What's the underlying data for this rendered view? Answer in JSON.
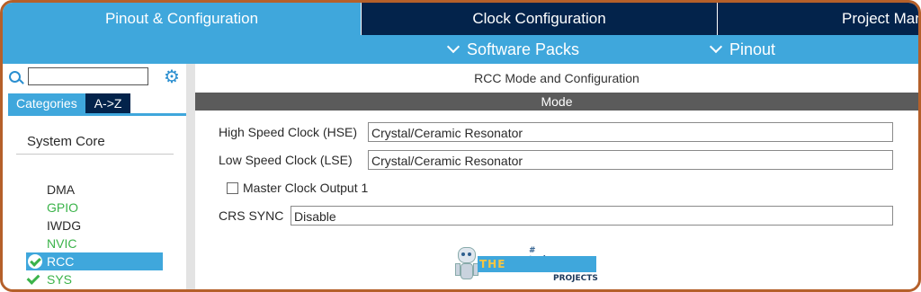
{
  "tabs": [
    "Pinout & Configuration",
    "Clock Configuration",
    "Project Manager"
  ],
  "subbar": [
    "Software Packs",
    "Pinout"
  ],
  "sidebar": {
    "category_tabs": [
      "Categories",
      "A->Z"
    ],
    "section": "System Core",
    "items": [
      {
        "label": "DMA",
        "color": "#2a2a2a",
        "state": "none"
      },
      {
        "label": "GPIO",
        "color": "#3bb34a",
        "state": "none"
      },
      {
        "label": "IWDG",
        "color": "#2a2a2a",
        "state": "none"
      },
      {
        "label": "NVIC",
        "color": "#3bb34a",
        "state": "none"
      },
      {
        "label": "RCC",
        "color": "#ffffff",
        "state": "selected-checked"
      },
      {
        "label": "SYS",
        "color": "#3bb34a",
        "state": "checked"
      }
    ]
  },
  "main": {
    "title": "RCC Mode and Configuration",
    "mode_header": "Mode",
    "hse_label": "High Speed Clock (HSE)",
    "hse_value": "Crystal/Ceramic Resonator",
    "lse_label": "Low Speed Clock (LSE)",
    "lse_value": "Crystal/Ceramic Resonator",
    "mco_label": "Master Clock Output 1",
    "crs_label": "CRS SYNC",
    "crs_value": "Disable"
  },
  "logo": {
    "tagline": "# technopreneur",
    "name_the": "THE",
    "name_main": "ENGINEERING",
    "name_sub": "PROJECTS"
  },
  "colors": {
    "accent": "#3fa7dc",
    "dark_tab": "#03234b",
    "frame": "#b5602a",
    "enabled_green": "#3bb34a"
  }
}
